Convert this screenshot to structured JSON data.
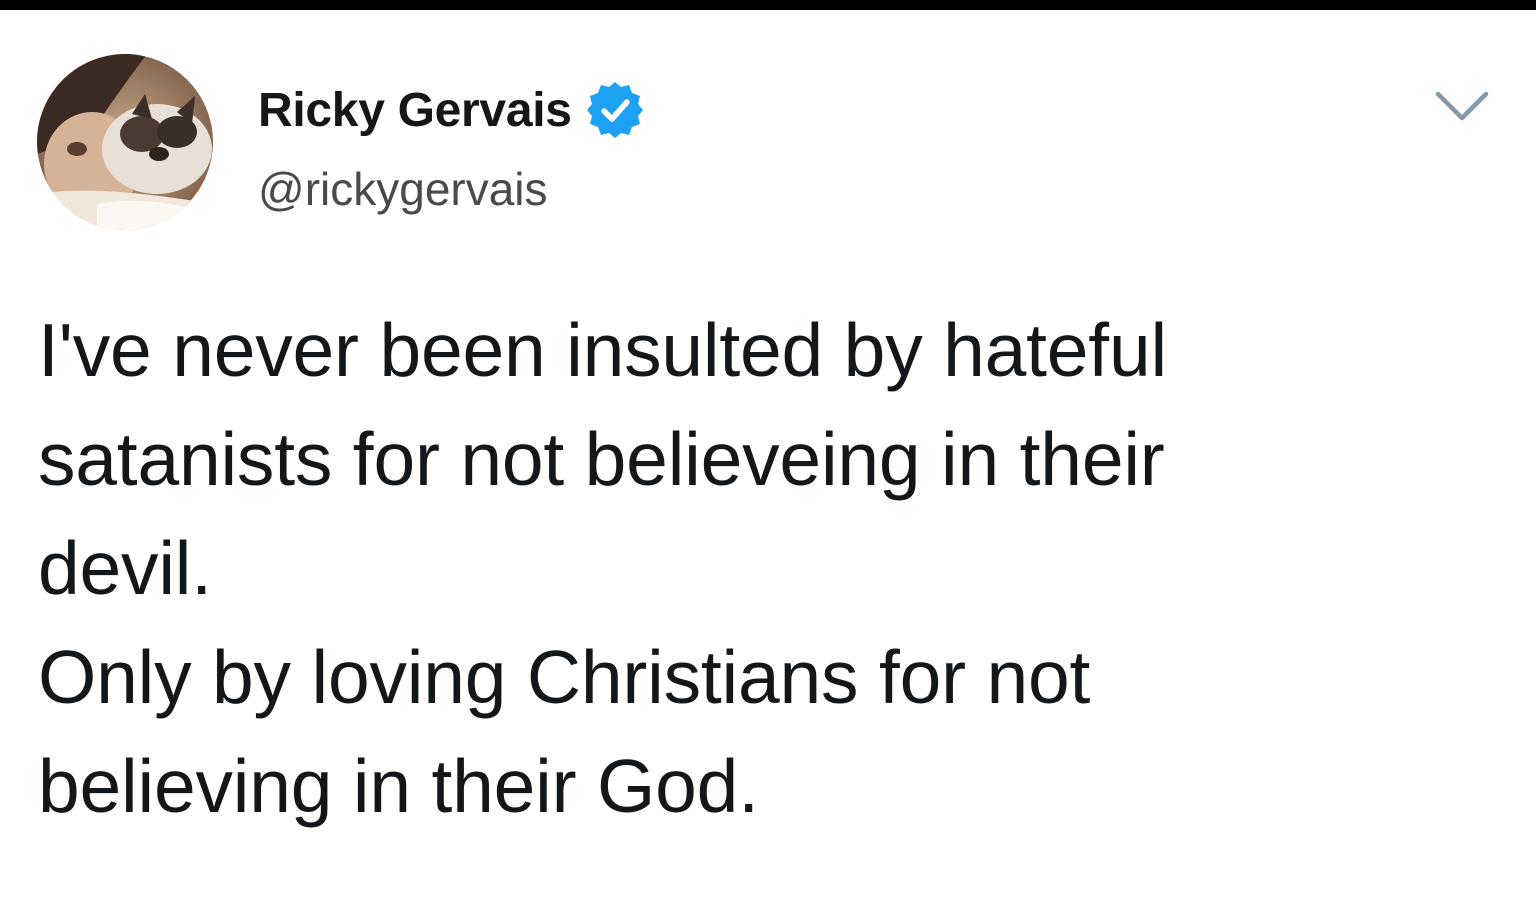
{
  "tweet": {
    "author": {
      "display_name": "Ricky Gervais",
      "handle": "@rickygervais",
      "verified": true,
      "avatar_icon": "profile-photo-avatar",
      "verified_icon": "verified-badge-icon"
    },
    "menu_icon": "chevron-down-icon",
    "text_lines": [
      "I've never been insulted by hateful",
      "satanists for not believeing in their",
      "devil.",
      "Only by loving Christians for not",
      "believing in their God."
    ]
  },
  "colors": {
    "top_bar": "#000000",
    "background": "#ffffff",
    "text": "#14171a",
    "handle": "#4a4a4a",
    "verified_blue": "#1da1f2",
    "caret": "#8899a6"
  }
}
